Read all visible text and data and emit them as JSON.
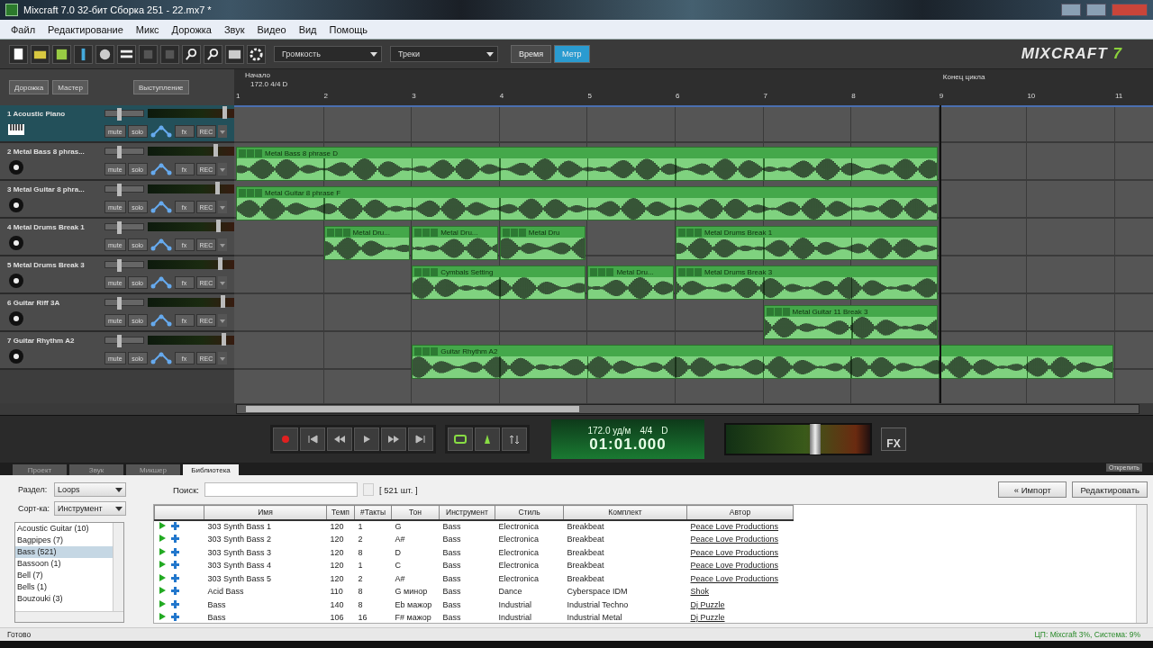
{
  "window": {
    "title": "Mixcraft 7.0 32-бит Сборка 251 - 22.mx7 *"
  },
  "menu": [
    "Файл",
    "Редактирование",
    "Микс",
    "Дорожка",
    "Звук",
    "Видео",
    "Вид",
    "Помощь"
  ],
  "toolbar": {
    "dropdowns": [
      "Громкость",
      "Треки"
    ],
    "view_buttons": [
      {
        "label": "Время",
        "selected": false
      },
      {
        "label": "Метр",
        "selected": true
      }
    ],
    "logo": {
      "word": "MIXCRAFT",
      "number": "7"
    }
  },
  "header_buttons": [
    "Дорожка",
    "Мастер",
    "Выступление"
  ],
  "ruler": {
    "start_label": "Начало",
    "start_info": "172.0 4/4 D",
    "bars": [
      "1",
      "2",
      "3",
      "4",
      "5",
      "6",
      "7",
      "8",
      "9",
      "10",
      "11"
    ],
    "cycle_end": "Конец цикла"
  },
  "tracks": [
    {
      "name": "1 Acoustic Piano",
      "kind": "instrument",
      "selected": true,
      "volume": {
        "level": 0.35
      },
      "pan": {
        "level": 0.85
      },
      "buttons": [
        "mute",
        "solo",
        "fx",
        "REC"
      ]
    },
    {
      "name": "2 Metal Bass 8 phras...",
      "kind": "audio",
      "selected": false,
      "volume": {
        "level": 0.35
      },
      "pan": {
        "level": 0.75
      },
      "buttons": [
        "mute",
        "solo",
        "fx",
        "REC"
      ],
      "clips": [
        {
          "title": "Metal Bass 8 phrase D"
        }
      ]
    },
    {
      "name": "3 Metal Guitar 8 phra...",
      "kind": "audio",
      "selected": false,
      "volume": {
        "level": 0.35
      },
      "pan": {
        "level": 0.77
      },
      "buttons": [
        "mute",
        "solo",
        "fx",
        "REC"
      ],
      "clips": [
        {
          "title": "Metal Guitar 8 phrase F"
        }
      ]
    },
    {
      "name": "4 Metal Drums Break 1",
      "kind": "audio",
      "selected": false,
      "volume": {
        "level": 0.35
      },
      "pan": {
        "level": 0.78
      },
      "buttons": [
        "mute",
        "solo",
        "fx",
        "REC"
      ],
      "clips": [
        {
          "title": "Metal Dru..."
        },
        {
          "title": "Metal Dru..."
        },
        {
          "title": "Metal Dru"
        },
        {
          "title": "Metal Drums Break 1"
        }
      ]
    },
    {
      "name": "5 Metal Drums Break 3",
      "kind": "audio",
      "selected": false,
      "volume": {
        "level": 0.35
      },
      "pan": {
        "level": 0.8
      },
      "buttons": [
        "mute",
        "solo",
        "fx",
        "REC"
      ],
      "clips": [
        {
          "title": "Cymbals Setting"
        },
        {
          "title": "Metal Dru..."
        },
        {
          "title": "Metal Drums Break 3"
        }
      ]
    },
    {
      "name": "6 Guitar Riff 3A",
      "kind": "audio",
      "selected": false,
      "volume": {
        "level": 0.35
      },
      "pan": {
        "level": 0.83
      },
      "buttons": [
        "mute",
        "solo",
        "fx",
        "REC"
      ],
      "clips": [
        {
          "title": "Metal Guitar 11 Break 3"
        }
      ]
    },
    {
      "name": "7 Guitar Rhythm A2",
      "kind": "audio",
      "selected": false,
      "volume": {
        "level": 0.35
      },
      "pan": {
        "level": 0.84
      },
      "buttons": [
        "mute",
        "solo",
        "fx",
        "REC"
      ],
      "clips": [
        {
          "title": "Guitar Rhythm A2"
        }
      ]
    }
  ],
  "transport": {
    "tempo": "172.0 уд/м",
    "meter": "4/4",
    "key": "D",
    "time": "01:01.000",
    "master": {
      "level": 0.62
    },
    "fx": "FX"
  },
  "bottom_tabs": [
    {
      "label": "Проект",
      "selected": false
    },
    {
      "label": "Звук",
      "selected": false
    },
    {
      "label": "Микшер",
      "selected": false
    },
    {
      "label": "Библиотека",
      "selected": true
    }
  ],
  "undock": "Открепить",
  "library": {
    "section_label": "Раздел:",
    "section": "Loops",
    "sort_label": "Сорт-ка:",
    "sort": "Инструмент",
    "categories": [
      {
        "label": "Acoustic Guitar  (10)",
        "selected": false
      },
      {
        "label": "Bagpipes  (7)",
        "selected": false
      },
      {
        "label": "Bass  (521)",
        "selected": true
      },
      {
        "label": "Bassoon  (1)",
        "selected": false
      },
      {
        "label": "Bell  (7)",
        "selected": false
      },
      {
        "label": "Bells  (1)",
        "selected": false
      },
      {
        "label": "Bouzouki  (3)",
        "selected": false
      }
    ],
    "search_label": "Поиск:",
    "count": "[ 521 шт. ]",
    "import_button": "« Импорт",
    "edit_button": "Редактировать",
    "columns": [
      "Имя",
      "Темп",
      "#Такты",
      "Тон",
      "Инструмент",
      "Стиль",
      "Комплект",
      "Автор"
    ],
    "rows": [
      [
        "303 Synth Bass 1",
        "120",
        "1",
        "G",
        "Bass",
        "Electronica",
        "Breakbeat",
        "Peace Love Productions"
      ],
      [
        "303 Synth Bass 2",
        "120",
        "2",
        "A#",
        "Bass",
        "Electronica",
        "Breakbeat",
        "Peace Love Productions"
      ],
      [
        "303 Synth Bass 3",
        "120",
        "8",
        "D",
        "Bass",
        "Electronica",
        "Breakbeat",
        "Peace Love Productions"
      ],
      [
        "303 Synth Bass 4",
        "120",
        "1",
        "C",
        "Bass",
        "Electronica",
        "Breakbeat",
        "Peace Love Productions"
      ],
      [
        "303 Synth Bass 5",
        "120",
        "2",
        "A#",
        "Bass",
        "Electronica",
        "Breakbeat",
        "Peace Love Productions"
      ],
      [
        "Acid Bass",
        "110",
        "8",
        "G минор",
        "Bass",
        "Dance",
        "Cyberspace IDM",
        "Shok"
      ],
      [
        "Bass",
        "140",
        "8",
        "Eb мажор",
        "Bass",
        "Industrial",
        "Industrial Techno",
        "Dj Puzzle"
      ],
      [
        "Bass",
        "106",
        "16",
        "F# мажор",
        "Bass",
        "Industrial",
        "Industrial Metal",
        "Dj Puzzle"
      ]
    ]
  },
  "status": {
    "left": "Готово",
    "right": "ЦП: Mixcraft 3%, Система: 9%"
  }
}
